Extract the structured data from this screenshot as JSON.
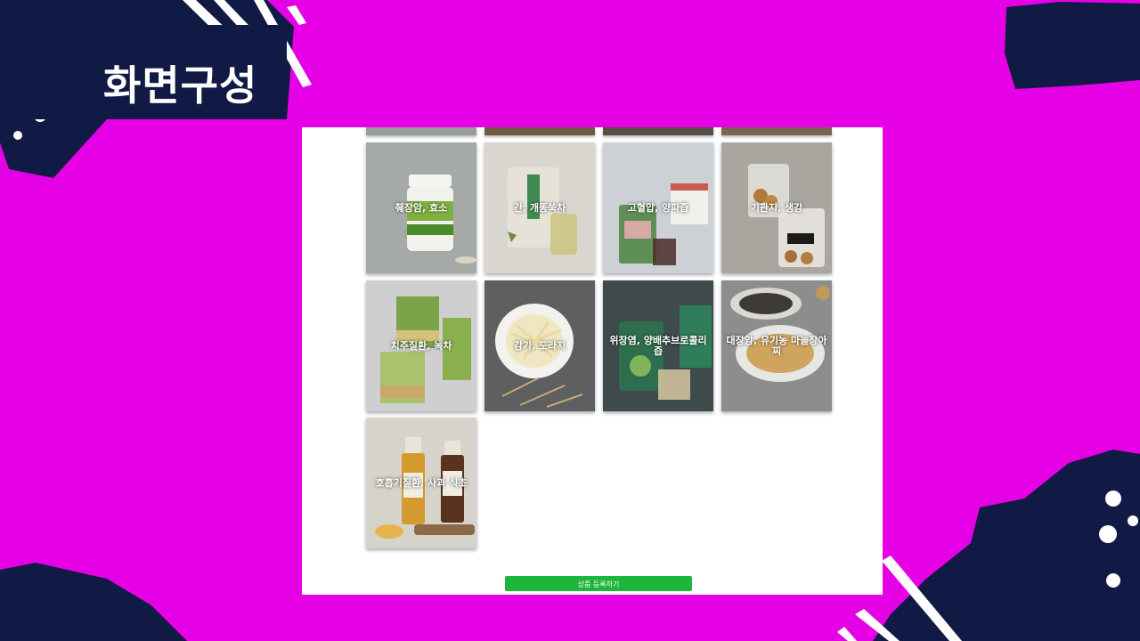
{
  "slide": {
    "title": "화면구성",
    "colors": {
      "background": "#e600e6",
      "navy": "#111a44",
      "button": "#1bb63a"
    }
  },
  "tiles": [
    {
      "label": "췌장암, 효소",
      "image": "enzyme-jar-photo"
    },
    {
      "label": "간, 개똥쑥차",
      "image": "tea-bag-pouch-photo"
    },
    {
      "label": "고혈압, 양파즙",
      "image": "onion-juice-pouch-photo"
    },
    {
      "label": "기관지, 생강",
      "image": "ginger-snack-bag-photo"
    },
    {
      "label": "치주질환, 녹차",
      "image": "green-tea-box-photo"
    },
    {
      "label": "감기, 도라지",
      "image": "bellflower-root-plate-photo"
    },
    {
      "label": "위장염, 양배추브로콜리즙",
      "image": "cabbage-juice-pouch-photo"
    },
    {
      "label": "대장암, 유기농 마늘장아찌",
      "image": "pickled-garlic-bowl-photo"
    },
    {
      "label": "호흡기질환, 사과 식초",
      "image": "vinegar-bottles-photo"
    }
  ],
  "actions": {
    "register_label": "상품 등록하기"
  }
}
